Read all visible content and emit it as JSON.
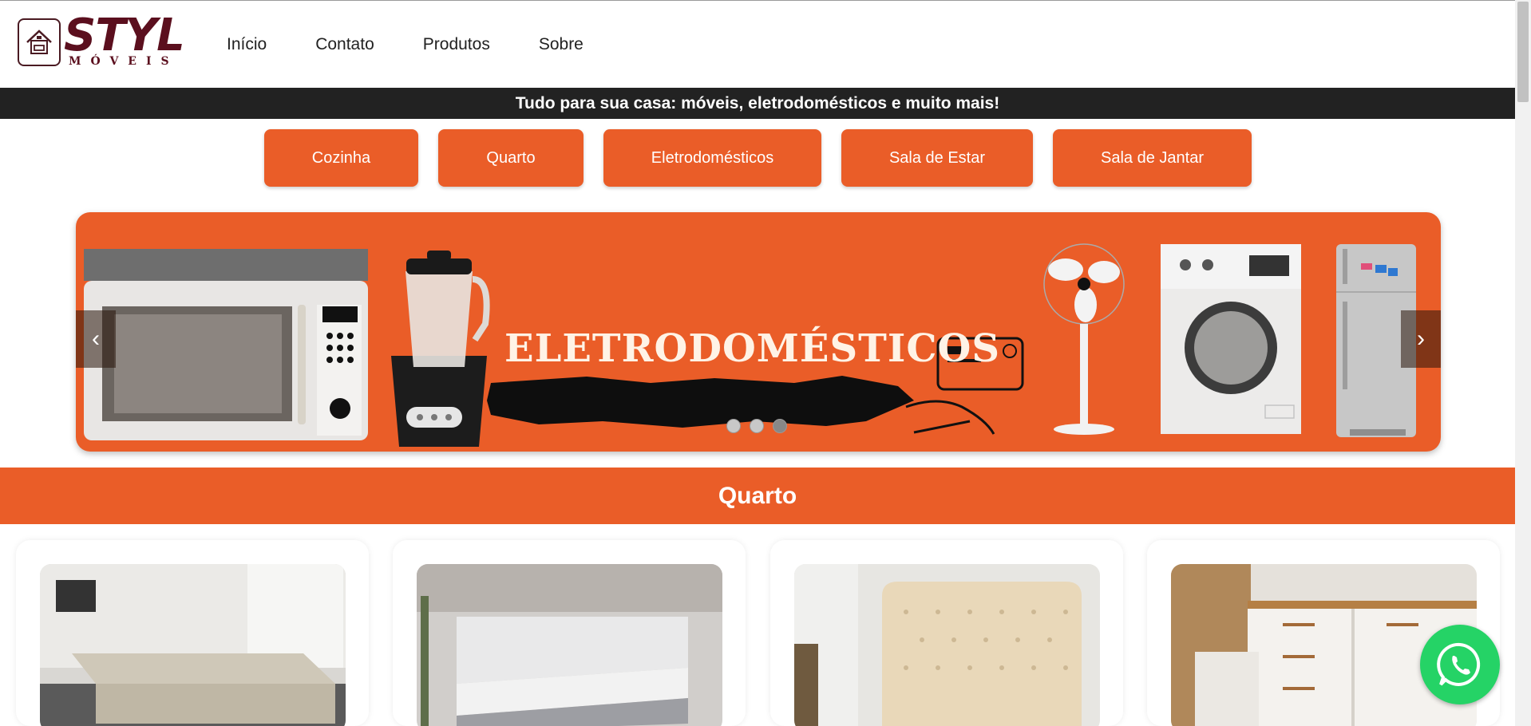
{
  "header": {
    "logo_word": "STYL",
    "logo_sub": "MÓVEIS",
    "nav": [
      "Início",
      "Contato",
      "Produtos",
      "Sobre"
    ]
  },
  "strip": {
    "text": "Tudo para sua casa: móveis, eletrodomésticos e muito mais!"
  },
  "categories": [
    "Cozinha",
    "Quarto",
    "Eletrodomésticos",
    "Sala de Estar",
    "Sala de Jantar"
  ],
  "carousel": {
    "title": "ELETRODOMÉSTICOS",
    "prev_label": "‹",
    "next_label": "›",
    "slides": 3,
    "active_slide": 3
  },
  "section": {
    "title": "Quarto"
  },
  "products": [
    {
      "name": "box-bed-base"
    },
    {
      "name": "mattress-box-set"
    },
    {
      "name": "tufted-headboard"
    },
    {
      "name": "dresser-chest"
    }
  ],
  "colors": {
    "accent": "#ea5d28",
    "strip": "#222222",
    "brand": "#5b0f1e",
    "whatsapp": "#25d366"
  }
}
